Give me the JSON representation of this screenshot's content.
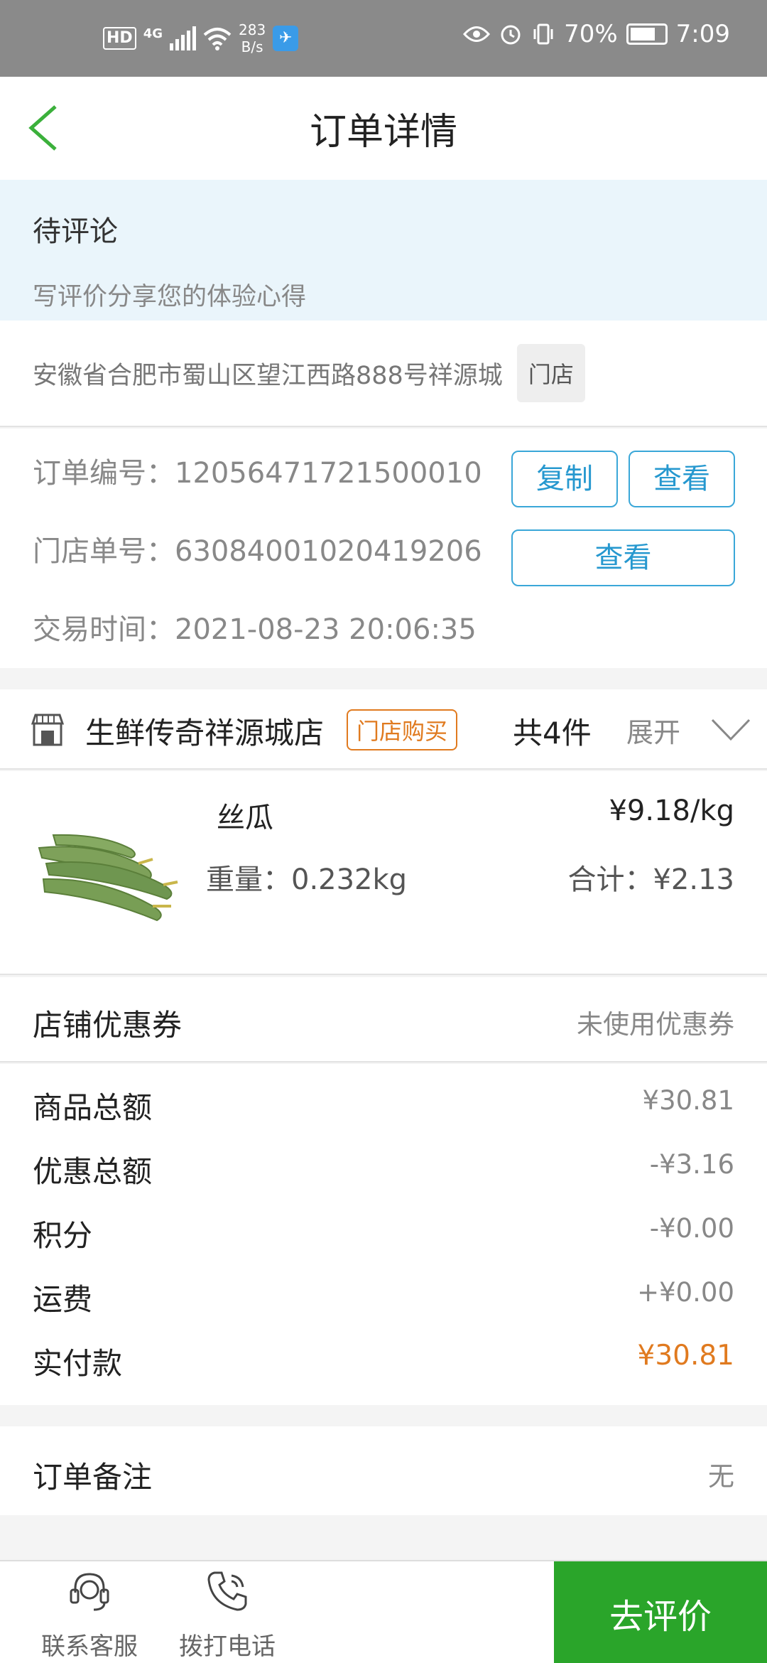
{
  "status_bar": {
    "hd": "HD",
    "network": "4G",
    "speed_value": "283",
    "speed_unit": "B/s",
    "battery": "70%",
    "time": "7:09"
  },
  "header": {
    "title": "订单详情"
  },
  "review_banner": {
    "status": "待评论",
    "subtitle": "写评价分享您的体验心得"
  },
  "address": {
    "text": "安徽省合肥市蜀山区望江西路888号祥源城",
    "tag": "门店"
  },
  "order_info": {
    "order_no_label": "订单编号：",
    "order_no": "12056471721500010",
    "copy_label": "复制",
    "view_label": "查看",
    "store_no_label": "门店单号：",
    "store_no": "63084001020419206",
    "store_view_label": "查看",
    "time_label": "交易时间：",
    "time": "2021-08-23 20:06:35"
  },
  "store": {
    "name": "生鲜传奇祥源城店",
    "badge": "门店购买",
    "count": "共4件",
    "expand": "展开"
  },
  "product": {
    "name": "丝瓜",
    "price": "¥9.18/kg",
    "weight": "重量：0.232kg",
    "subtotal": "合计：¥2.13"
  },
  "coupon": {
    "label": "店铺优惠券",
    "value": "未使用优惠券"
  },
  "summary": {
    "total_label": "商品总额",
    "total": "¥30.81",
    "discount_label": "优惠总额",
    "discount": "-¥3.16",
    "points_label": "积分",
    "points": "-¥0.00",
    "shipping_label": "运费",
    "shipping": "+¥0.00",
    "paid_label": "实付款",
    "paid": "¥30.81"
  },
  "remark": {
    "label": "订单备注",
    "value": "无"
  },
  "bottom_bar": {
    "service_label": "联系客服",
    "phone_label": "拨打电话",
    "review_label": "去评价"
  },
  "colors": {
    "accent_green": "#2aa52a",
    "link_blue": "#2698cf",
    "price_orange": "#e07a1f",
    "banner_bg": "#eaf5fb"
  }
}
